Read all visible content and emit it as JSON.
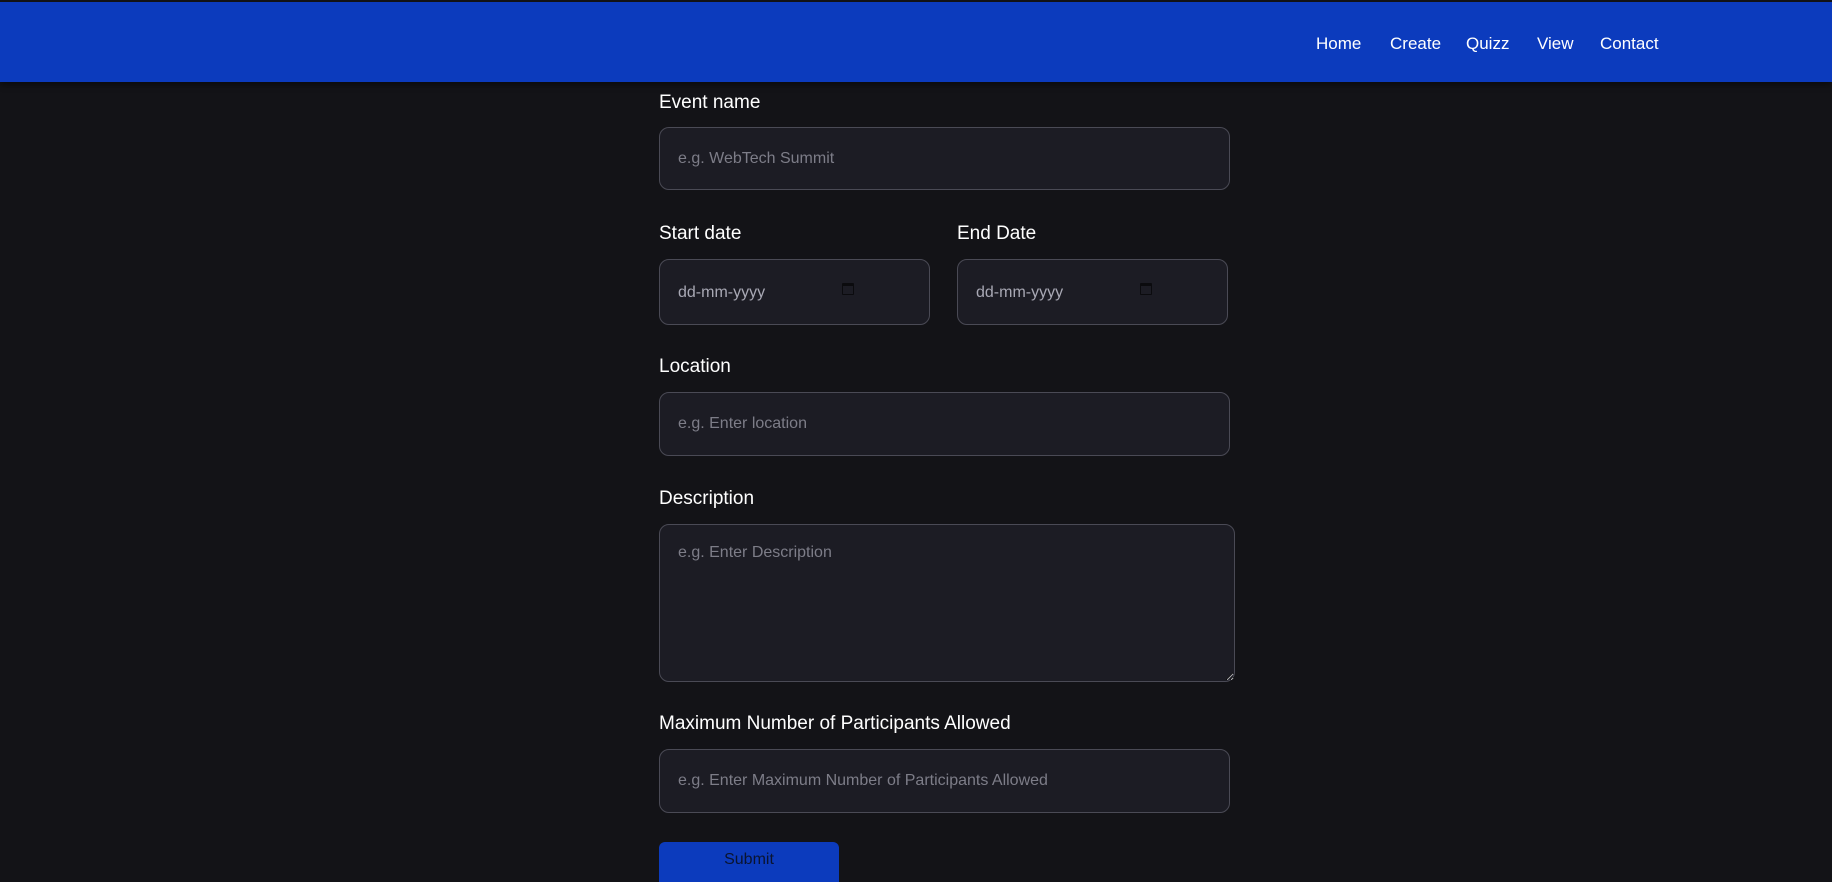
{
  "nav": {
    "items": [
      {
        "label": "Home"
      },
      {
        "label": "Create"
      },
      {
        "label": "Quizz"
      },
      {
        "label": "View"
      },
      {
        "label": "Contact"
      }
    ]
  },
  "form": {
    "event_name": {
      "label": "Event name",
      "placeholder": "e.g. WebTech Summit",
      "value": ""
    },
    "start_date": {
      "label": "Start date",
      "placeholder": "dd-mm-yyyy",
      "icon": "calendar-icon"
    },
    "end_date": {
      "label": "End Date",
      "placeholder": "dd-mm-yyyy",
      "icon": "calendar-icon"
    },
    "location": {
      "label": "Location",
      "placeholder": "e.g. Enter location",
      "value": ""
    },
    "description": {
      "label": "Description",
      "placeholder": "e.g. Enter Description",
      "value": ""
    },
    "max_participants": {
      "label": "Maximum Number of Participants Allowed",
      "placeholder": "e.g. Enter Maximum Number of Participants Allowed",
      "value": ""
    },
    "submit_label": "Submit"
  },
  "colors": {
    "navbar": "#0c3bbd",
    "page_background": "#131317",
    "field_background": "#1c1c24",
    "field_border": "#4a4a55",
    "submit_button": "#0c3bbd"
  }
}
